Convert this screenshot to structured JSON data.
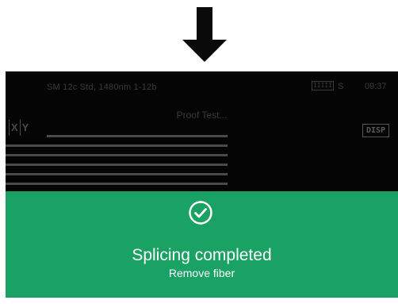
{
  "status_bar": {
    "program": "SM 12c Std, 1480nm 1-12b",
    "battery_label": "IIIII",
    "battery_suffix": "S",
    "time": "09:37"
  },
  "mode_label": "Proof Test...",
  "view_toggle": {
    "left_mark": "",
    "x_label": "X",
    "y_label": "Y"
  },
  "disp_button": "DISP",
  "banner": {
    "title": "Splicing completed",
    "subtitle": "Remove fiber",
    "icon": "check-circle-icon",
    "color": "#1aa164"
  },
  "indicator": {
    "icon": "down-arrow-icon"
  }
}
